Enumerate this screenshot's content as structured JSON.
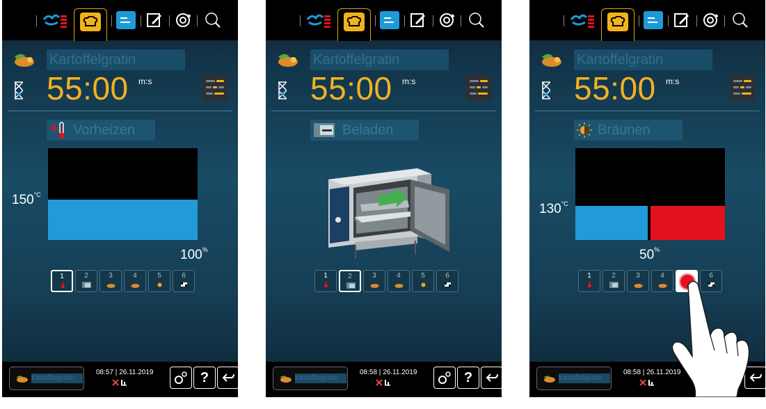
{
  "program_name": "Kartoffelgratin",
  "timer": {
    "value": "55:00",
    "unit": "m:s"
  },
  "screens": [
    {
      "step": "Vorheizen",
      "step_icon": "thermometer-preheat-icon",
      "temperature": "150",
      "temperature_unit": "°C",
      "fan_speed": "100",
      "fan_unit": "%",
      "active_step": 1,
      "time": "08:57",
      "date": "26.11.2019"
    },
    {
      "step": "Beladen",
      "step_icon": "load-icon",
      "active_step": 2,
      "time": "08:58",
      "date": "26.11.2019"
    },
    {
      "step": "Bräunen",
      "step_icon": "browning-icon",
      "temperature": "130",
      "temperature_unit": "°C",
      "fan_speed": "50",
      "fan_unit": "%",
      "active_step": 5,
      "time": "08:58",
      "date": "26.11.2019"
    }
  ],
  "step_numbers": [
    "1",
    "2",
    "3",
    "4",
    "5",
    "6"
  ],
  "colors": {
    "accent": "#f2b224",
    "blue": "#219bd8",
    "red": "#e2121e"
  }
}
